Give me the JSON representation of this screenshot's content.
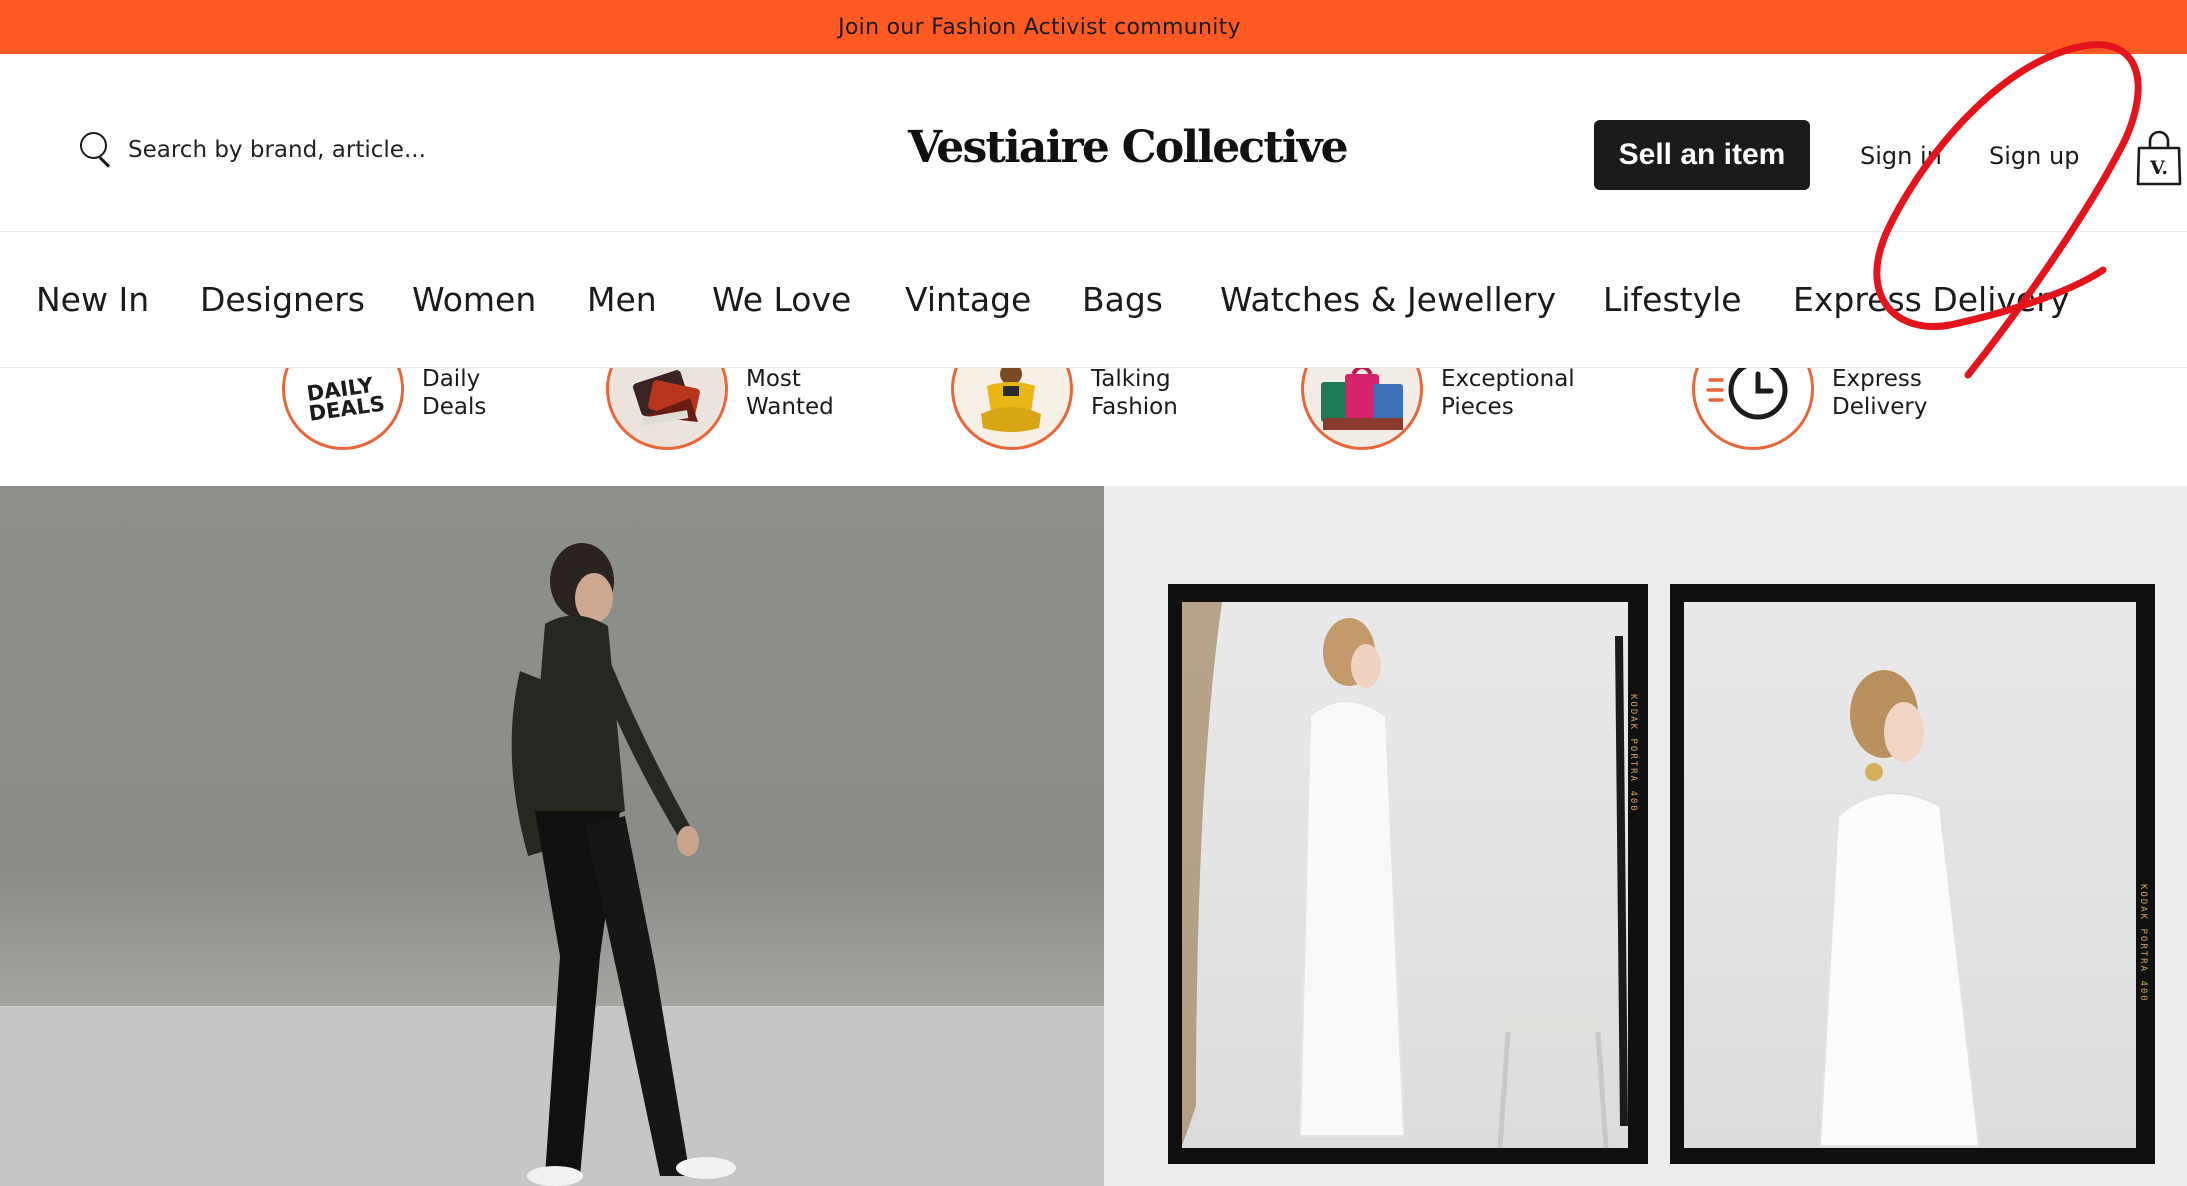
{
  "banner": {
    "text": "Join our Fashion Activist community",
    "color": "#ff5a23"
  },
  "header": {
    "search_placeholder": "Search by brand, article...",
    "logo": "Vestiaire Collective",
    "sell_label": "Sell an item",
    "sign_in": "Sign in",
    "sign_up": "Sign up",
    "bag_icon_letter": "V."
  },
  "nav": {
    "items": [
      "New In",
      "Designers",
      "Women",
      "Men",
      "We Love",
      "Vintage",
      "Bags",
      "Watches & Jewellery",
      "Lifestyle",
      "Express Delivery"
    ]
  },
  "categories": [
    {
      "line1": "Daily",
      "line2": "Deals",
      "icon": "daily-deals-badge",
      "badge_text1": "DAILY",
      "badge_text2": "DEALS"
    },
    {
      "line1": "Most",
      "line2": "Wanted",
      "icon": "handbags-thumbnail"
    },
    {
      "line1": "Talking",
      "line2": "Fashion",
      "icon": "talking-fashion-thumbnail"
    },
    {
      "line1": "Exceptional",
      "line2": "Pieces",
      "icon": "exceptional-bags-thumbnail"
    },
    {
      "line1": "Express",
      "line2": "Delivery",
      "icon": "clock-icon"
    }
  ],
  "hero": {
    "left_image": "model-walking-black-outfit",
    "right_image": "film-frames-white-outfit",
    "film_text": "KODAK PORTRA 400"
  },
  "annotation": {
    "color": "#e3141b"
  }
}
